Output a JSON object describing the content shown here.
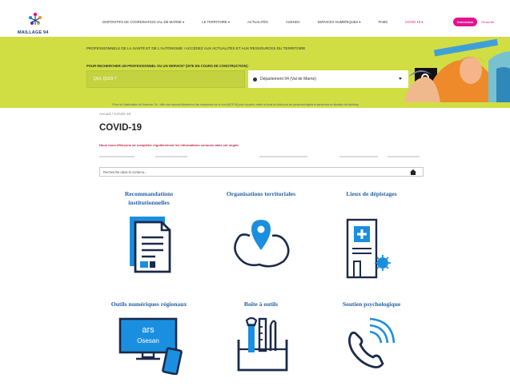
{
  "brand": {
    "name": "MAILLAGE 94"
  },
  "nav": {
    "items": [
      {
        "label": "Dispositifs de coordination Val-de-Marne ▾",
        "highlight": false
      },
      {
        "label": "Le territoire ▾",
        "highlight": false
      },
      {
        "label": "Actualités",
        "highlight": false
      },
      {
        "label": "Agenda",
        "highlight": false
      },
      {
        "label": "Services numériques ▾",
        "highlight": false
      },
      {
        "label": "PAMS",
        "highlight": false
      },
      {
        "label": "COVID 19 ▾",
        "highlight": true
      }
    ],
    "cta_label": "Connexion",
    "cta_secondary": "S'inscrire"
  },
  "hero": {
    "title": "Professionnels de la santé et de l'autonomie ! Accédez aux actualités et aux ressources du territoire",
    "search_label": "Pour rechercher un professionnel ou un service* (site en cours de construction) :",
    "search_placeholder": "QUI, QUOI ?",
    "location_value": "Département 94 (Val de Marne)",
    "strip_text": "*Pour la Collaboration de l'exercice. Ex : offre une réponse illustrant un lien ressources sur le nom (MCS 94) pour la partie, mette un local du cible pour les personnes âgées et personnes en situation de handicap"
  },
  "content": {
    "breadcrumb": "Accueil  /  COVID-19",
    "page_title": "COVID-19",
    "notice": "Nous nous efforçons de compléter régulièrement les informations connues dans cet onglet.",
    "search_placeholder": "Recherche dans le contenu..."
  },
  "tiles": [
    {
      "label": "Recommandations institutionnelles",
      "icon": "document-icon"
    },
    {
      "label": "Organisations territoriales",
      "icon": "map-pin-icon"
    },
    {
      "label": "Lieux de dépistages",
      "icon": "medical-building-icon"
    },
    {
      "label": "Outils numériques régionaux",
      "icon": "computer-phone-icon",
      "screen_text_1": "ars",
      "screen_text_2": "Osesan"
    },
    {
      "label": "Boîte à outils",
      "icon": "toolbox-icon"
    },
    {
      "label": "Soutien psychologique",
      "icon": "phone-icon"
    }
  ],
  "colors": {
    "accent": "#e3128e",
    "hero": "#d0de44",
    "tile_label": "#2461a8",
    "icon_blue": "#1a8fe0",
    "icon_dark": "#1b2a4a"
  }
}
